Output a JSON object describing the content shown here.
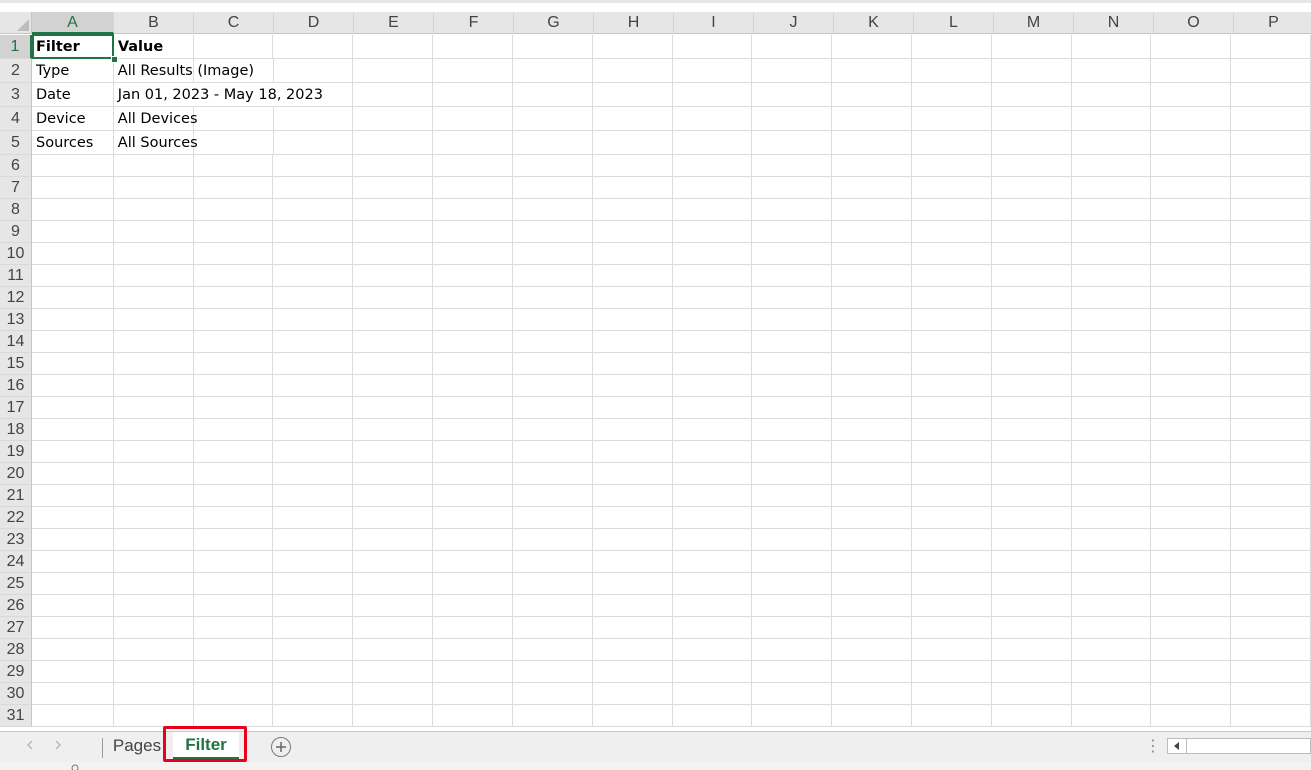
{
  "columns": [
    "A",
    "B",
    "C",
    "D",
    "E",
    "F",
    "G",
    "H",
    "I",
    "J",
    "K",
    "L",
    "M",
    "N",
    "O",
    "P"
  ],
  "rows": [
    "1",
    "2",
    "3",
    "4",
    "5",
    "6",
    "7",
    "8",
    "9",
    "10",
    "11",
    "12",
    "13",
    "14",
    "15",
    "16",
    "17",
    "18",
    "19",
    "20",
    "21",
    "22",
    "23",
    "24",
    "25",
    "26",
    "27",
    "28",
    "29",
    "30",
    "31"
  ],
  "active_cell": "A1",
  "cells": {
    "A1": "Filter",
    "B1": "Value",
    "A2": "Type",
    "B2": "All Results (Image)",
    "A3": "Date",
    "B3": "Jan 01, 2023 - May 18, 2023",
    "A4": "Device",
    "B4": "All Devices",
    "A5": "Sources",
    "B5": "All Sources"
  },
  "sheet_tabs": [
    {
      "label": "Pages",
      "active": false
    },
    {
      "label": "Filter",
      "active": true
    }
  ],
  "colors": {
    "accent": "#217346",
    "highlight_box": "#e8001c",
    "header_bg": "#e6e6e6",
    "gridline": "#dcdcdc"
  },
  "icons": {
    "prev_sheet": "chevron-left-icon",
    "next_sheet": "chevron-right-icon",
    "add_sheet": "plus-circle-icon",
    "scroll_left": "triangle-left-icon"
  }
}
